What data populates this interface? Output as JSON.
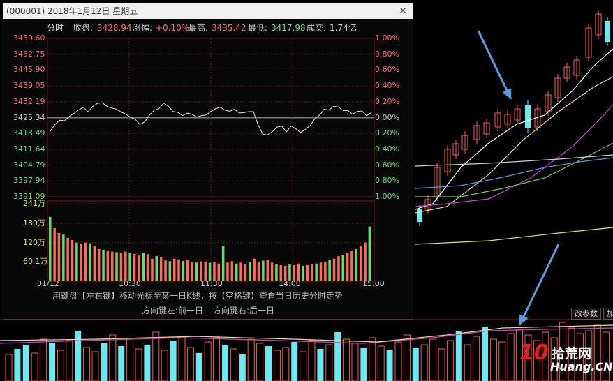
{
  "window": {
    "title": "(000001) 2018年1月12日 星期五",
    "close_glyph": "✕"
  },
  "info_bar": {
    "label_intraday": "分时",
    "close_label": "收盘:",
    "close_value": "3428.94",
    "change_label": "涨幅:",
    "change_value": "+0.10%",
    "high_label": "最高:",
    "high_value": "3435.42",
    "low_label": "最低:",
    "low_value": "3417.98",
    "volume_label": "成交:",
    "volume_value": "1.74亿"
  },
  "price_axis": {
    "left": [
      "3459.60",
      "3452.75",
      "3445.90",
      "3439.05",
      "3432.19",
      "3425.34",
      "3418.49",
      "3411.64",
      "3404.79",
      "3397.94",
      "3391.09"
    ],
    "right": [
      "1.00%",
      "0.80%",
      "0.60%",
      "0.40%",
      "0.20%",
      "0.00%",
      "0.20%",
      "0.40%",
      "0.60%",
      "0.80%",
      "1.00%"
    ]
  },
  "volume_axis": [
    "241万",
    "180万",
    "120万",
    "60.1万"
  ],
  "time_axis": [
    "01/12",
    "10:30",
    "11:30",
    "14:00",
    "15:00"
  ],
  "hint": {
    "line1": "用鍵盘【左右键】移动光标至某一日K线，按【空格键】查看当日历史分时走势",
    "line2_left": "方向键左:前一日",
    "line2_right": "方向键右:后一日"
  },
  "buttons": {
    "params": "改参数",
    "add": "加"
  },
  "watermark": {
    "number": "10",
    "brand": "拾荒网",
    "domain": "Huang.CN"
  },
  "colors": {
    "up": "#ff5b4a",
    "down": "#6de8f0",
    "ma_white": "#ffffff",
    "ma_yellow": "#e8e070",
    "ma_magenta": "#d040e0",
    "ma_green": "#70d050",
    "ma_blue": "#40a0e0",
    "arrow": "#5b9be0"
  },
  "chart_data": {
    "type": "line",
    "title": "",
    "x": [
      "01/12",
      "10:30",
      "11:30",
      "14:00",
      "15:00"
    ],
    "ylim": [
      3391.09,
      3459.6
    ],
    "baseline": 3425.34,
    "series": [
      {
        "price": [
          3419.5,
          3422.4,
          3424.2,
          3424.0,
          3425.8,
          3427.1,
          3428.6,
          3429.8,
          3427.8,
          3430.2,
          3431.5,
          3431.8,
          3430.2,
          3429.5,
          3429.0,
          3427.8,
          3426.8,
          3425.5,
          3424.6,
          3422.4,
          3423.5,
          3426.4,
          3428.5,
          3429.2,
          3431.6,
          3430.2,
          3428.0,
          3427.6,
          3426.2,
          3427.3,
          3426.8,
          3425.6,
          3426.2,
          3426.5,
          3428.0,
          3429.2,
          3429.8,
          3428.5,
          3428.1,
          3428.9,
          3427.3,
          3427.5,
          3427.9,
          3427.9,
          3422.2,
          3418.1,
          3417.9,
          3419.2,
          3421.2,
          3421.7,
          3419.2,
          3421.7,
          3420.5,
          3418.9,
          3420.2,
          3421.8,
          3424.8,
          3426.4,
          3429.0,
          3428.6,
          3430.2,
          3429.9,
          3428.4,
          3428.4,
          3426.8,
          3428.0,
          3428.2,
          3426.1,
          3427.6
        ]
      },
      {
        "volume": [
          200,
          165,
          150,
          145,
          135,
          128,
          120,
          115,
          120,
          118,
          110,
          100,
          98,
          95,
          92,
          90,
          88,
          92,
          87,
          85,
          80,
          88,
          84,
          70,
          78,
          75,
          65,
          62,
          70,
          68,
          63,
          66,
          60,
          58,
          62,
          60,
          57,
          60,
          55,
          110,
          58,
          62,
          55,
          58,
          53,
          60,
          70,
          60,
          64,
          66,
          58,
          52,
          50,
          48,
          52,
          50,
          55,
          48,
          50,
          52,
          55,
          58,
          60,
          66,
          70,
          78,
          82,
          88,
          94,
          100,
          110,
          120,
          170
        ]
      }
    ]
  }
}
